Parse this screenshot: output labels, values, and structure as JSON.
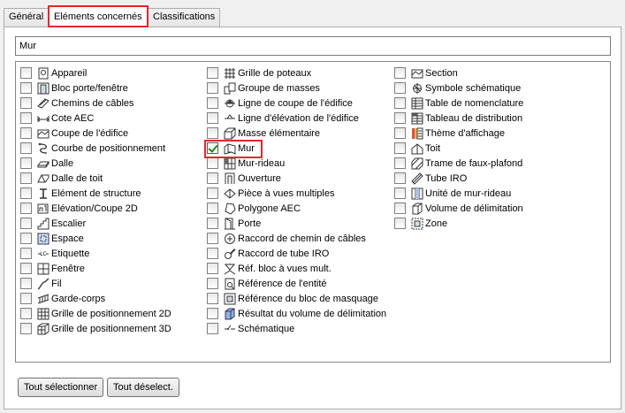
{
  "tabs": [
    "Général",
    "Eléments concernés",
    "Classifications"
  ],
  "search": {
    "value": "Mur"
  },
  "columns": [
    [
      {
        "label": "Appareil",
        "icon": "device-icon"
      },
      {
        "label": "Bloc porte/fenêtre",
        "icon": "door-window-block-icon"
      },
      {
        "label": "Chemins de câbles",
        "icon": "cable-tray-icon"
      },
      {
        "label": "Cote AEC",
        "icon": "dimension-icon"
      },
      {
        "label": "Coupe de l'édifice",
        "icon": "section-icon"
      },
      {
        "label": "Courbe de positionnement",
        "icon": "curve-icon"
      },
      {
        "label": "Dalle",
        "icon": "slab-icon"
      },
      {
        "label": "Dalle de toit",
        "icon": "roof-slab-icon"
      },
      {
        "label": "Elément de structure",
        "icon": "structural-member-icon"
      },
      {
        "label": "Elévation/Coupe 2D",
        "icon": "elevation-icon"
      },
      {
        "label": "Escalier",
        "icon": "stair-icon"
      },
      {
        "label": "Espace",
        "icon": "space-icon"
      },
      {
        "label": "Etiquette",
        "icon": "tag-icon"
      },
      {
        "label": "Fenêtre",
        "icon": "window-icon"
      },
      {
        "label": "Fil",
        "icon": "wire-icon"
      },
      {
        "label": "Garde-corps",
        "icon": "railing-icon"
      },
      {
        "label": "Grille de positionnement 2D",
        "icon": "grid-2d-icon"
      },
      {
        "label": "Grille de positionnement 3D",
        "icon": "grid-3d-icon"
      }
    ],
    [
      {
        "label": "Grille de poteaux",
        "icon": "column-grid-icon"
      },
      {
        "label": "Groupe de masses",
        "icon": "mass-group-icon"
      },
      {
        "label": "Ligne de coupe de l'édifice",
        "icon": "section-line-icon"
      },
      {
        "label": "Ligne d'élévation de l'édifice",
        "icon": "elevation-line-icon"
      },
      {
        "label": "Masse élémentaire",
        "icon": "mass-element-icon"
      },
      {
        "label": "Mur",
        "icon": "wall-icon",
        "checked": true
      },
      {
        "label": "Mur-rideau",
        "icon": "curtain-wall-icon"
      },
      {
        "label": "Ouverture",
        "icon": "opening-icon"
      },
      {
        "label": "Pièce à vues multiples",
        "icon": "multi-view-part-icon"
      },
      {
        "label": "Polygone AEC",
        "icon": "polygon-icon"
      },
      {
        "label": "Porte",
        "icon": "door-icon"
      },
      {
        "label": "Raccord de chemin de câbles",
        "icon": "cable-fitting-icon"
      },
      {
        "label": "Raccord de tube IRO",
        "icon": "conduit-fitting-icon"
      },
      {
        "label": "Réf. bloc à vues mult.",
        "icon": "multi-view-block-icon"
      },
      {
        "label": "Référence de l'entité",
        "icon": "entity-reference-icon"
      },
      {
        "label": "Référence du bloc de masquage",
        "icon": "mask-block-icon"
      },
      {
        "label": "Résultat du volume de délimitation",
        "icon": "bounding-result-icon"
      },
      {
        "label": "Schématique",
        "icon": "schematic-icon"
      }
    ],
    [
      {
        "label": "Section",
        "icon": "section-icon"
      },
      {
        "label": "Symbole schématique",
        "icon": "schematic-symbol-icon"
      },
      {
        "label": "Table de nomenclature",
        "icon": "schedule-table-icon"
      },
      {
        "label": "Tableau de distribution",
        "icon": "panel-icon"
      },
      {
        "label": "Thème d'affichage",
        "icon": "display-theme-icon"
      },
      {
        "label": "Toit",
        "icon": "roof-icon"
      },
      {
        "label": "Trame de faux-plafond",
        "icon": "ceiling-grid-icon"
      },
      {
        "label": "Tube IRO",
        "icon": "conduit-icon"
      },
      {
        "label": "Unité de mur-rideau",
        "icon": "curtain-unit-icon"
      },
      {
        "label": "Volume de délimitation",
        "icon": "bounding-volume-icon"
      },
      {
        "label": "Zone",
        "icon": "zone-icon"
      }
    ]
  ],
  "buttons": {
    "select_all": "Tout sélectionner",
    "deselect_all": "Tout déselect."
  },
  "colors": {
    "highlight": "#e3262d",
    "check": "#1a8a1a"
  }
}
